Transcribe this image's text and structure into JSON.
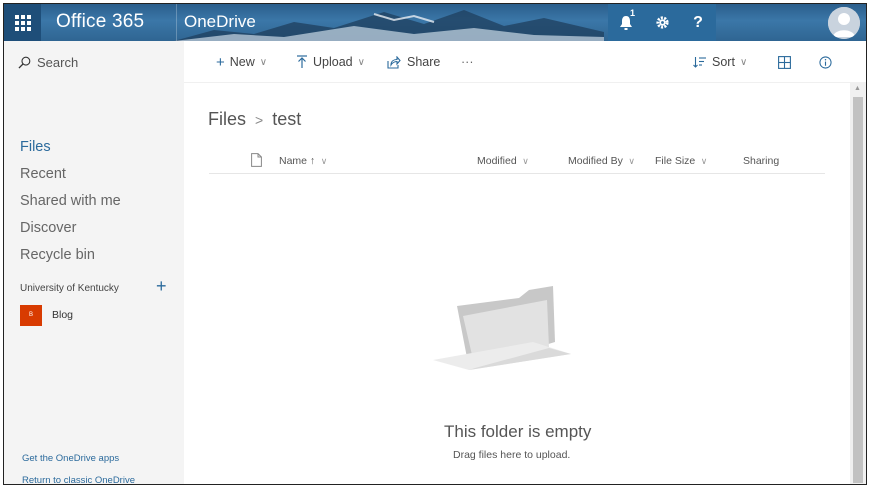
{
  "topbar": {
    "brand": "Office 365",
    "app_name": "OneDrive",
    "notification_count": "1",
    "help_label": "?"
  },
  "command_bar": {
    "search_placeholder": "Search",
    "new_label": "New",
    "upload_label": "Upload",
    "share_label": "Share",
    "more_label": "···",
    "sort_label": "Sort"
  },
  "leftnav": {
    "items": [
      {
        "label": "Files",
        "active": true
      },
      {
        "label": "Recent",
        "active": false
      },
      {
        "label": "Shared with me",
        "active": false
      },
      {
        "label": "Discover",
        "active": false
      },
      {
        "label": "Recycle bin",
        "active": false
      }
    ],
    "org_name": "University of Kentucky",
    "site_tile_letter": "B",
    "site_name": "Blog",
    "footer_links": [
      "Get the OneDrive apps",
      "Return to classic OneDrive"
    ]
  },
  "main": {
    "breadcrumb": [
      "Files",
      "test"
    ],
    "columns": [
      "Name ↑",
      "Modified",
      "Modified By",
      "File Size",
      "Sharing"
    ],
    "empty_title": "This folder is empty",
    "empty_subtitle": "Drag files here to upload."
  },
  "colors": {
    "accent": "#2b6a9c",
    "site_tile": "#d83b01",
    "nav_bg": "#f4f4f4"
  }
}
